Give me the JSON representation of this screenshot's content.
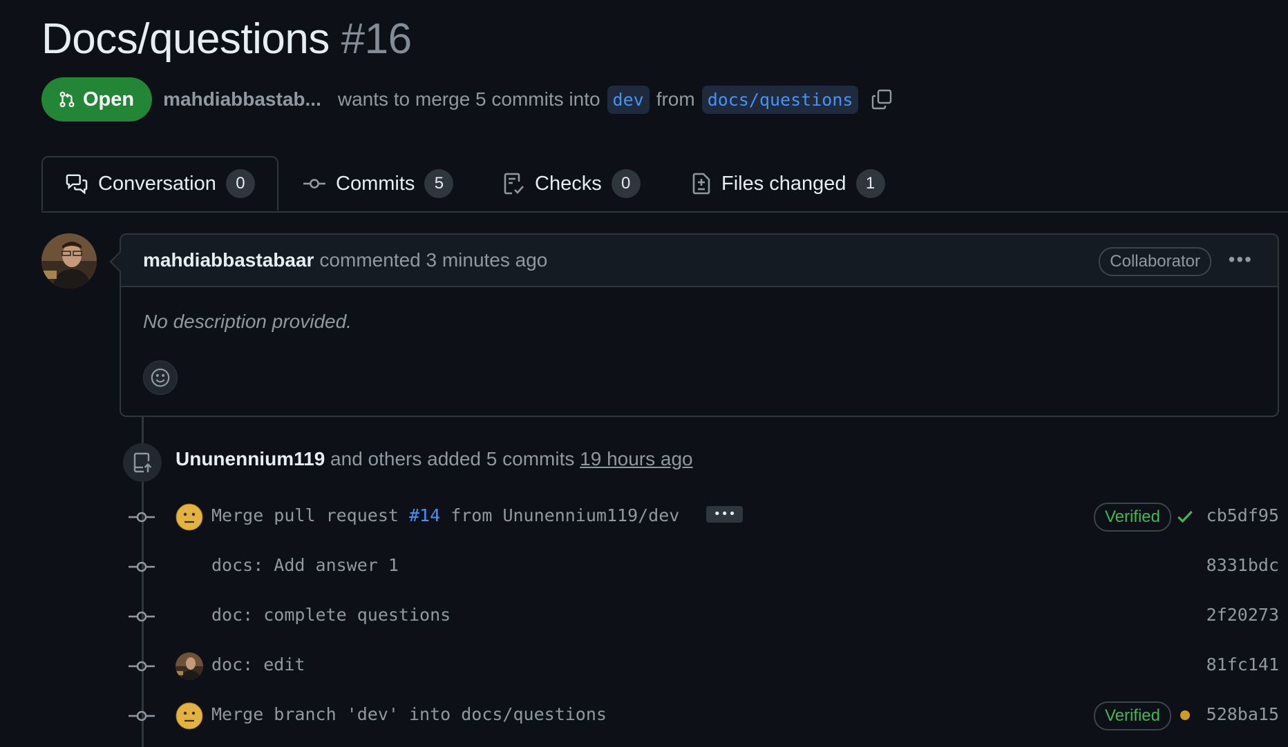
{
  "pr": {
    "title": "Docs/questions",
    "number": "#16",
    "state": "Open",
    "author_truncated": "mahdiabbastab...",
    "merge_text_1": "wants to merge 5 commits into",
    "base_branch": "dev",
    "merge_text_2": "from",
    "head_branch": "docs/questions"
  },
  "tabs": [
    {
      "label": "Conversation",
      "count": "0",
      "icon": "comment-discussion-icon"
    },
    {
      "label": "Commits",
      "count": "5",
      "icon": "git-commit-icon"
    },
    {
      "label": "Checks",
      "count": "0",
      "icon": "checklist-icon"
    },
    {
      "label": "Files changed",
      "count": "1",
      "icon": "file-diff-icon"
    }
  ],
  "comment": {
    "author": "mahdiabbastabaar",
    "action": "commented 3 minutes ago",
    "role": "Collaborator",
    "body": "No description provided."
  },
  "timeline": {
    "push_user": "Ununennium119",
    "push_text": "and others added 5 commits",
    "push_time": "19 hours ago",
    "commits": [
      {
        "msg_prefix": "Merge pull request ",
        "msg_link": "#14",
        "msg_suffix": " from Ununennium119/dev",
        "sha": "cb5df95",
        "verified": "Verified",
        "status": "success",
        "avatar": "emoji"
      },
      {
        "message": "docs: Add answer 1",
        "sha": "8331bdc"
      },
      {
        "message": "doc: complete questions",
        "sha": "2f20273"
      },
      {
        "message": "doc: edit",
        "sha": "81fc141",
        "avatar": "photo"
      },
      {
        "message": "Merge branch 'dev' into docs/questions",
        "sha": "528ba15",
        "verified": "Verified",
        "status": "pending",
        "avatar": "emoji"
      }
    ]
  },
  "colors": {
    "open_green": "#238636",
    "link_blue": "#4493f8",
    "verified_green": "#3fb950",
    "pending_yellow": "#d29922",
    "background": "#0d1117"
  }
}
